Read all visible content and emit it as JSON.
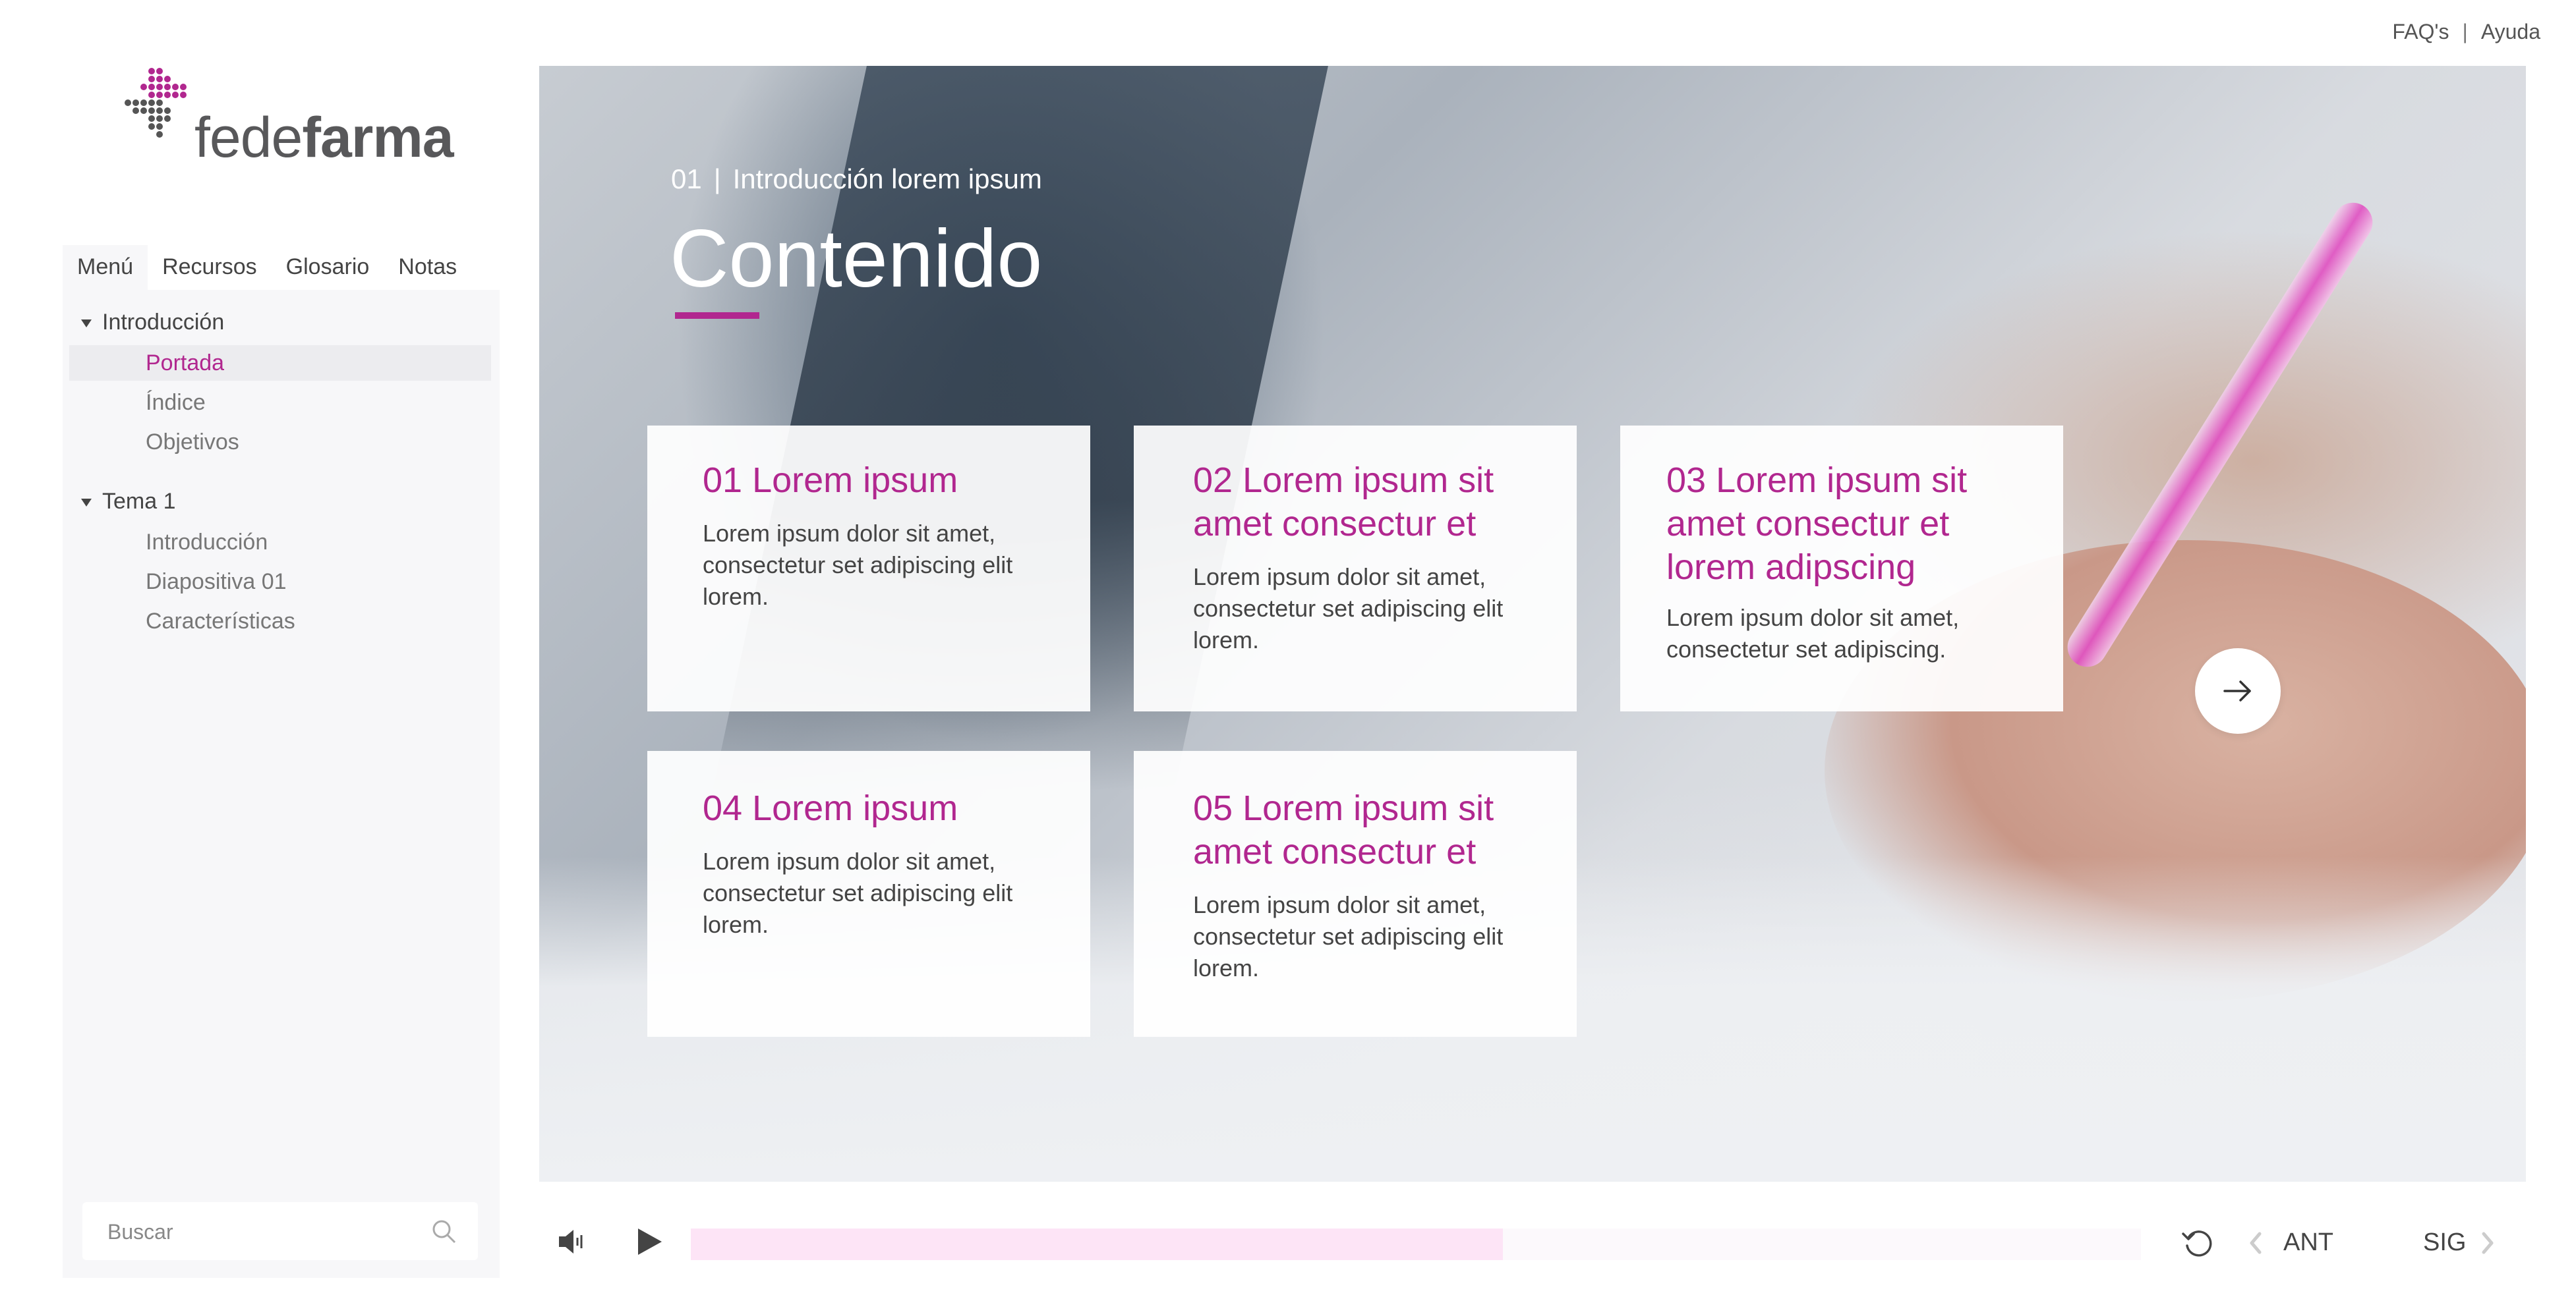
{
  "header": {
    "links": [
      "FAQ's",
      "Ayuda"
    ],
    "separator": "|"
  },
  "brand": {
    "name_light": "fede",
    "name_bold": "farma",
    "accent": "#b1278f"
  },
  "sidebar": {
    "tabs": [
      "Menú",
      "Recursos",
      "Glosario",
      "Notas"
    ],
    "active_tab": "Menú",
    "groups": [
      {
        "label": "Introducción",
        "items": [
          "Portada",
          "Índice",
          "Objetivos"
        ],
        "active_item": "Portada"
      },
      {
        "label": "Tema 1",
        "items": [
          "Introducción",
          "Diapositiva 01",
          "Características"
        ]
      }
    ],
    "search_placeholder": "Buscar"
  },
  "slide": {
    "number": "01",
    "separator": "|",
    "section": "Introducción lorem ipsum",
    "title": "Contenido",
    "cards": [
      {
        "title": "01 Lorem ipsum",
        "body": "Lorem ipsum dolor sit amet, consectetur set adipiscing elit lorem."
      },
      {
        "title": "02 Lorem ipsum sit amet consectur et",
        "body": "Lorem ipsum dolor sit amet, consectetur set adipiscing elit lorem."
      },
      {
        "title": "03 Lorem ipsum sit amet consectur et lorem adipscing",
        "body": "Lorem ipsum dolor sit amet, consectetur set adipiscing."
      },
      {
        "title": "04 Lorem ipsum",
        "body": "Lorem ipsum dolor sit amet, consectetur set adipiscing elit lorem."
      },
      {
        "title": "05 Lorem ipsum sit amet consectur et",
        "body": "Lorem ipsum dolor sit amet, consectetur set adipiscing elit lorem."
      }
    ]
  },
  "player": {
    "progress": 0.56,
    "prev_label": "ANT",
    "next_label": "SIG"
  },
  "icons": [
    "logo-mark-icon",
    "search-icon",
    "arrow-right-icon",
    "volume-icon",
    "play-icon",
    "replay-icon",
    "chevron-left-icon",
    "chevron-right-icon"
  ]
}
